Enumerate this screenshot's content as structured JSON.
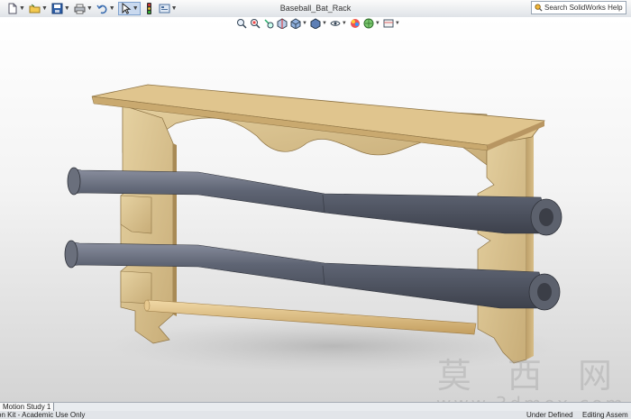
{
  "window": {
    "document_title": "Baseball_Bat_Rack",
    "search_placeholder": "Search SolidWorks Help"
  },
  "toolbar": {
    "items": [
      {
        "icon": "new-document-icon"
      },
      {
        "icon": "open-folder-icon"
      },
      {
        "icon": "save-icon"
      },
      {
        "icon": "print-icon"
      },
      {
        "icon": "undo-icon"
      },
      {
        "icon": "select-arrow-icon",
        "active": true
      },
      {
        "icon": "rebuild-traffic-light-icon"
      },
      {
        "icon": "options-icon"
      }
    ]
  },
  "heads_up_view": {
    "items": [
      "zoom-to-fit-icon",
      "zoom-to-area-icon",
      "previous-view-icon",
      "section-view-icon",
      "view-orientation-icon",
      "display-style-icon",
      "hide-show-items-icon",
      "edit-appearance-icon",
      "apply-scene-icon",
      "view-settings-icon"
    ]
  },
  "model": {
    "name": "Baseball_Bat_Rack",
    "wood_color": "#d8c08f",
    "bat_color": "#6c717d",
    "dowel_color": "#ddbf86"
  },
  "watermark": {
    "chinese": "莫 西 网",
    "url": "www.3dmox.com"
  },
  "tabs": {
    "motion_study": "Motion Study 1"
  },
  "status": {
    "left": "on Kit - Academic Use Only",
    "definition": "Under Defined",
    "editing": "Editing Assem"
  }
}
